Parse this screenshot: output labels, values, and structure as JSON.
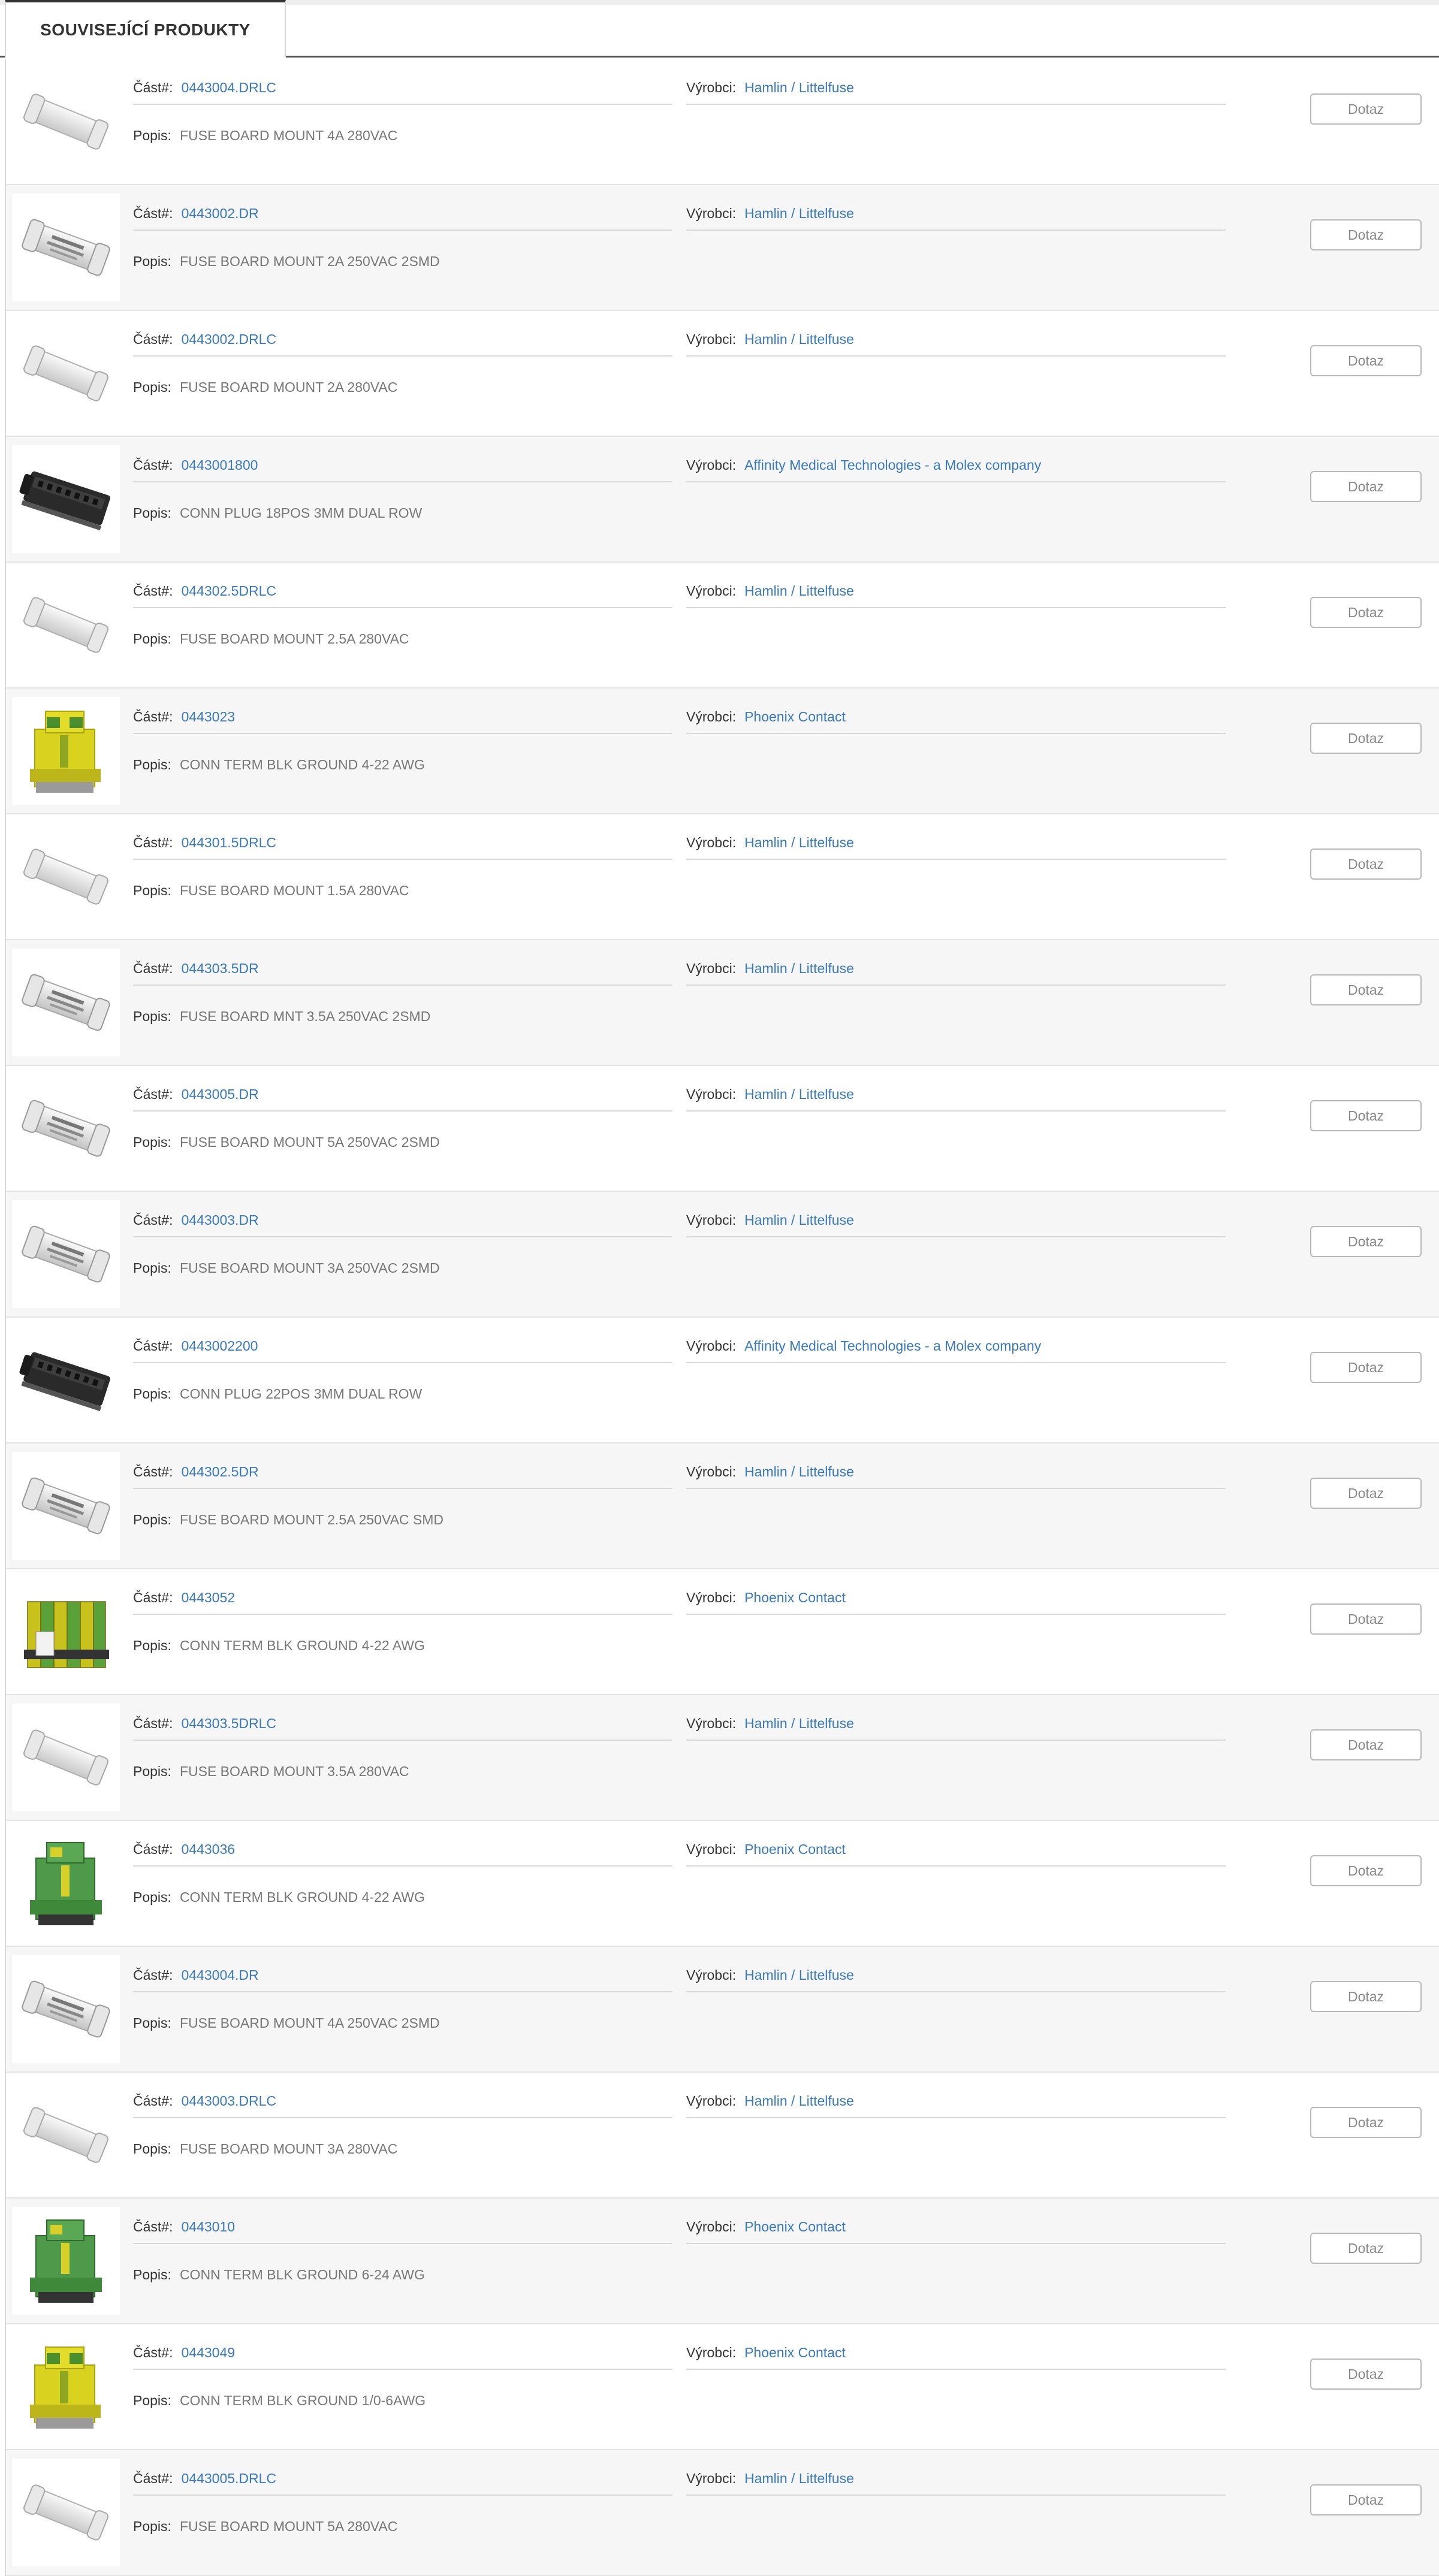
{
  "tabs": [
    {
      "label": "SOUVISEJÍCÍ PRODUKTY"
    }
  ],
  "labels": {
    "part": "Část#:",
    "manufacturer": "Výrobci:",
    "description": "Popis:",
    "button": "Dotaz"
  },
  "colors": {
    "link": "#3a7ab8",
    "text": "#777777",
    "row_alt": "#f6f6f6"
  },
  "products": [
    {
      "part": "0443004.DRLC",
      "manufacturer": "Hamlin / Littelfuse",
      "description": "FUSE BOARD MOUNT 4A 280VAC",
      "image": "fuse-icon"
    },
    {
      "part": "0443002.DR",
      "manufacturer": "Hamlin / Littelfuse",
      "description": "FUSE BOARD MOUNT 2A 250VAC 2SMD",
      "image": "fuse-smd-icon"
    },
    {
      "part": "0443002.DRLC",
      "manufacturer": "Hamlin / Littelfuse",
      "description": "FUSE BOARD MOUNT 2A 280VAC",
      "image": "fuse-icon"
    },
    {
      "part": "0443001800",
      "manufacturer": "Affinity Medical Technologies - a Molex company",
      "description": "CONN PLUG 18POS 3MM DUAL ROW",
      "image": "connector-plug-icon"
    },
    {
      "part": "044302.5DRLC",
      "manufacturer": "Hamlin / Littelfuse",
      "description": "FUSE BOARD MOUNT 2.5A 280VAC",
      "image": "fuse-icon"
    },
    {
      "part": "0443023",
      "manufacturer": "Phoenix Contact",
      "description": "CONN TERM BLK GROUND 4-22 AWG",
      "image": "terminal-block-yellow-icon"
    },
    {
      "part": "044301.5DRLC",
      "manufacturer": "Hamlin / Littelfuse",
      "description": "FUSE BOARD MOUNT 1.5A 280VAC",
      "image": "fuse-icon"
    },
    {
      "part": "044303.5DR",
      "manufacturer": "Hamlin / Littelfuse",
      "description": "FUSE BOARD MNT 3.5A 250VAC 2SMD",
      "image": "fuse-smd-icon"
    },
    {
      "part": "0443005.DR",
      "manufacturer": "Hamlin / Littelfuse",
      "description": "FUSE BOARD MOUNT 5A 250VAC 2SMD",
      "image": "fuse-smd-icon"
    },
    {
      "part": "0443003.DR",
      "manufacturer": "Hamlin / Littelfuse",
      "description": "FUSE BOARD MOUNT 3A 250VAC 2SMD",
      "image": "fuse-smd-icon"
    },
    {
      "part": "0443002200",
      "manufacturer": "Affinity Medical Technologies - a Molex company",
      "description": "CONN PLUG 22POS 3MM DUAL ROW",
      "image": "connector-plug-icon"
    },
    {
      "part": "044302.5DR",
      "manufacturer": "Hamlin / Littelfuse",
      "description": "FUSE BOARD MOUNT 2.5A 250VAC SMD",
      "image": "fuse-smd-icon"
    },
    {
      "part": "0443052",
      "manufacturer": "Phoenix Contact",
      "description": "CONN TERM BLK GROUND 4-22 AWG",
      "image": "terminal-block-multi-icon"
    },
    {
      "part": "044303.5DRLC",
      "manufacturer": "Hamlin / Littelfuse",
      "description": "FUSE BOARD MOUNT 3.5A 280VAC",
      "image": "fuse-icon"
    },
    {
      "part": "0443036",
      "manufacturer": "Phoenix Contact",
      "description": "CONN TERM BLK GROUND 4-22 AWG",
      "image": "terminal-block-green-icon"
    },
    {
      "part": "0443004.DR",
      "manufacturer": "Hamlin / Littelfuse",
      "description": "FUSE BOARD MOUNT 4A 250VAC 2SMD",
      "image": "fuse-smd-icon"
    },
    {
      "part": "0443003.DRLC",
      "manufacturer": "Hamlin / Littelfuse",
      "description": "FUSE BOARD MOUNT 3A 280VAC",
      "image": "fuse-icon"
    },
    {
      "part": "0443010",
      "manufacturer": "Phoenix Contact",
      "description": "CONN TERM BLK GROUND 6-24 AWG",
      "image": "terminal-block-green-icon"
    },
    {
      "part": "0443049",
      "manufacturer": "Phoenix Contact",
      "description": "CONN TERM BLK GROUND 1/0-6AWG",
      "image": "terminal-block-yellow-icon"
    },
    {
      "part": "0443005.DRLC",
      "manufacturer": "Hamlin / Littelfuse",
      "description": "FUSE BOARD MOUNT 5A 280VAC",
      "image": "fuse-icon"
    }
  ]
}
